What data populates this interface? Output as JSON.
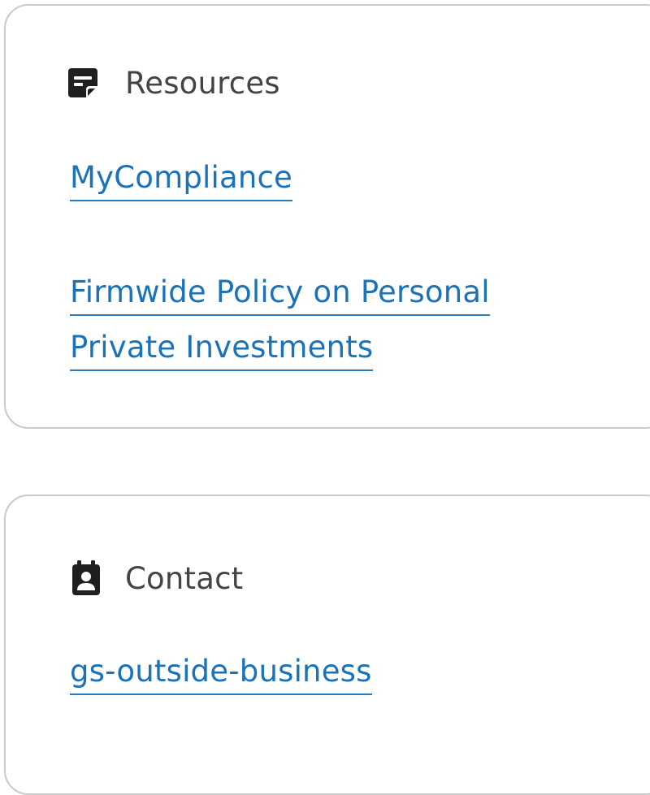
{
  "resources": {
    "title": "Resources",
    "icon": "note-icon",
    "links": [
      {
        "label": "MyCompliance"
      },
      {
        "label": "Firmwide Policy on Personal Private Investments"
      }
    ]
  },
  "contact": {
    "title": "Contact",
    "icon": "contact-card-icon",
    "link_label": "gs-outside-business"
  },
  "colors": {
    "link": "#1a72b9",
    "title": "#444444",
    "border": "#c9c9c9",
    "icon": "#1f1f1f"
  }
}
